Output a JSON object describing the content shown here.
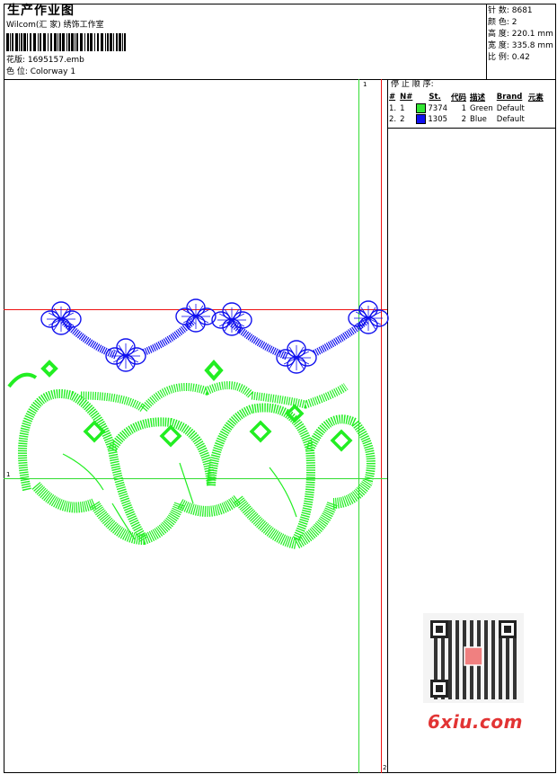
{
  "header": {
    "title": "生产作业图",
    "company": "Wilcom(汇 家) 绣饰工作室",
    "pattern_file": "花版: 1695157.emb",
    "colorway": "色 位: Colorway 1"
  },
  "stats": {
    "stitches": "针 数: 8681",
    "colors": "颜 色: 2",
    "height": "高 度: 220.1 mm",
    "width": "宽 度: 335.8 mm",
    "scale": "比 例: 0.42"
  },
  "stop_sequence": {
    "title": "停 止 顺 序:",
    "columns": [
      "#",
      "N#",
      "St.",
      "代码",
      "描述",
      "Brand",
      "元素"
    ],
    "rows": [
      {
        "idx": "1.",
        "n": "1",
        "color": "#33e633",
        "stitches": "7374",
        "code": "1",
        "desc": "Green",
        "brand": "Default"
      },
      {
        "idx": "2.",
        "n": "2",
        "color": "#1010f0",
        "stitches": "1305",
        "code": "2",
        "desc": "Blue",
        "brand": "Default"
      }
    ]
  },
  "markers": {
    "top": "1",
    "left": "1",
    "bottom": "2"
  },
  "watermark": {
    "site": "6xiu.com"
  },
  "colors": {
    "green": "#22ee22",
    "blue": "#1111ee",
    "red": "#ee1111",
    "guide_green": "#33dd33"
  }
}
